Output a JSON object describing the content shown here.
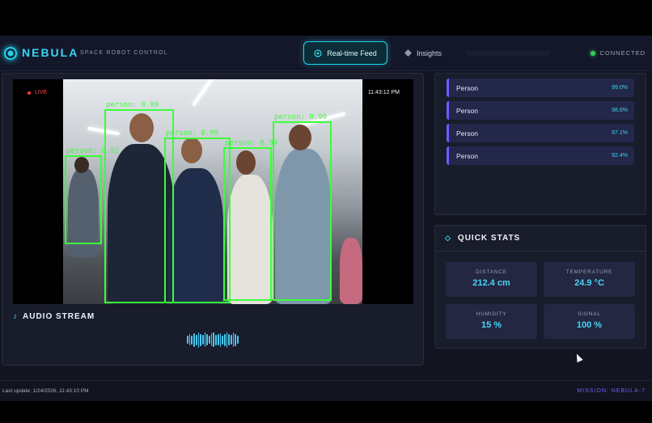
{
  "header": {
    "brand": "NEBULA",
    "subtitle": "SPACE ROBOT CONTROL",
    "tabs": [
      {
        "label": "Real-time Feed",
        "active": true
      },
      {
        "label": "Insights",
        "active": false
      }
    ],
    "connection_status": "CONNECTED"
  },
  "video": {
    "live_label": "LIVE",
    "timestamp": "11:43:12 PM",
    "detections": [
      {
        "label": "person: 0.92",
        "class": "person",
        "confidence": 0.92
      },
      {
        "label": "person: 0.99",
        "class": "person",
        "confidence": 0.99
      },
      {
        "label": "person: 0.99",
        "class": "person",
        "confidence": 0.99
      },
      {
        "label": "person: 0.99",
        "class": "person",
        "confidence": 0.99
      },
      {
        "label": "person: 0.90",
        "class": "person",
        "confidence": 0.9
      }
    ]
  },
  "audio": {
    "title": "AUDIO STREAM",
    "levels": [
      0.35,
      0.6,
      0.45,
      0.8,
      0.55,
      0.95,
      0.7,
      0.5,
      0.85,
      0.6,
      0.4,
      0.75,
      0.9,
      0.55,
      0.65,
      0.8,
      0.45,
      0.7,
      0.95,
      0.6,
      0.5,
      0.85,
      0.7,
      0.4
    ]
  },
  "detections_list": [
    {
      "label": "Person",
      "confidence": "99.0%"
    },
    {
      "label": "Person",
      "confidence": "98.6%"
    },
    {
      "label": "Person",
      "confidence": "97.1%"
    },
    {
      "label": "Person",
      "confidence": "92.4%"
    }
  ],
  "quick_stats": {
    "title": "QUICK STATS",
    "items": [
      {
        "label": "DISTANCE",
        "value": "212.4 cm"
      },
      {
        "label": "TEMPERATURE",
        "value": "24.9 °C"
      },
      {
        "label": "HUMIDITY",
        "value": "15 %"
      },
      {
        "label": "SIGNAL",
        "value": "100 %"
      }
    ]
  },
  "footer": {
    "last_update": "Last update: 1/24/2026, 11:43:10 PM",
    "mission": "MISSION: NEBULA-7"
  },
  "colors": {
    "accent": "#38d6f2",
    "detection_box": "#39ff39",
    "mission": "#7a5cff",
    "live": "#ff4b4b",
    "connected": "#34d058"
  },
  "icons": {
    "logo": "orb-icon",
    "feed_tab": "target-icon",
    "insights_tab": "diamond-icon",
    "audio": "music-note-icon",
    "stats": "diamond-outline-icon"
  }
}
